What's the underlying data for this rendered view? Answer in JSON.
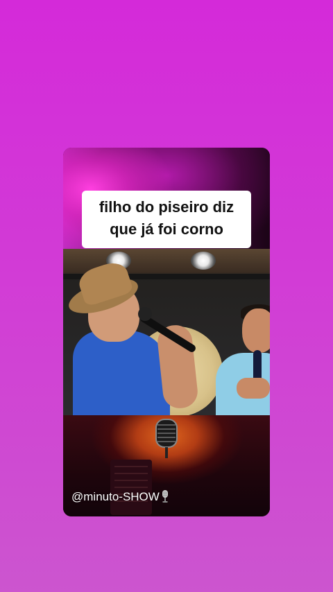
{
  "caption": {
    "lines": [
      "filho do piseiro diz",
      "que já foi corno"
    ]
  },
  "watermark": {
    "handle": "@minuto-SHOW",
    "icon": "studio-microphone-icon"
  },
  "colors": {
    "background": "#d42ad9",
    "caption_background": "#ffffff",
    "caption_text": "#111111"
  }
}
